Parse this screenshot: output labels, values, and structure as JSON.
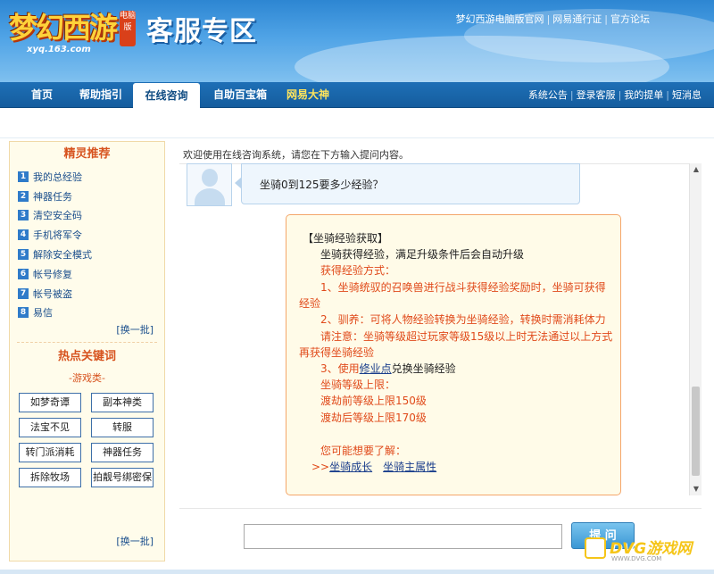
{
  "header": {
    "logo_text": "梦幻西游",
    "logo_badge": "电脑版",
    "logo_url": "xyq.163.com",
    "title": "客服专区",
    "links": [
      "梦幻西游电脑版官网",
      "网易通行证",
      "官方论坛"
    ]
  },
  "nav": {
    "tabs": [
      "首页",
      "帮助指引",
      "在线咨询",
      "自助百宝箱",
      "网易大神"
    ],
    "active_tab": "在线咨询",
    "right_links": [
      "系统公告",
      "登录客服",
      "我的提单",
      "短消息"
    ]
  },
  "sidebar": {
    "recommend_title": "精灵推荐",
    "items": [
      {
        "num": "1",
        "label": "我的总经验"
      },
      {
        "num": "2",
        "label": "神器任务"
      },
      {
        "num": "3",
        "label": "清空安全码"
      },
      {
        "num": "4",
        "label": "手机将军令"
      },
      {
        "num": "5",
        "label": "解除安全模式"
      },
      {
        "num": "6",
        "label": "帐号修复"
      },
      {
        "num": "7",
        "label": "帐号被盗"
      },
      {
        "num": "8",
        "label": "易信"
      }
    ],
    "refresh_label": "[换一批]",
    "hot_title": "热点关键词",
    "hot_category": "-游戏类-",
    "keywords": [
      "如梦奇谭",
      "副本神类",
      "法宝不见",
      "转服",
      "转门派消耗",
      "神器任务",
      "拆除牧场",
      "拍靓号绑密保"
    ],
    "refresh_label2": "[换一批]"
  },
  "chat": {
    "welcome": "欢迎使用在线咨询系统，请您在下方输入提问内容。",
    "question": "坐骑0到125要多少经验？",
    "answer": {
      "heading": "【坐骑经验获取】",
      "intro": "坐骑获得经验，满足升级条件后会自动升级",
      "method_title": "获得经验方式：",
      "method1_line1": "1、坐骑统驭的召唤兽进行战斗获得经验奖励时，坐骑可获得",
      "method1_line2": "经验",
      "method2": "2、驯养：可将人物经验转换为坐骑经验，转换时需消耗体力",
      "note_line1": "请注意：坐骑等级超过玩家等级15级以上时无法通过以上方式",
      "note_line2": "再获得坐骑经验",
      "method3_prefix": "3、使用",
      "method3_link": "修业点",
      "method3_suffix": "兑换坐骑经验",
      "limit_title": "坐骑等级上限：",
      "limit1": "渡劫前等级上限150级",
      "limit2": "渡劫后等级上限170级",
      "more_title": "您可能想要了解：",
      "more_prefix": ">>",
      "more_link1": "坐骑成长",
      "more_link2": "坐骑主属性"
    },
    "input_value": "",
    "submit_label": "提 问"
  },
  "watermark": {
    "text": "DVG游戏网",
    "sub": "WWW.DVG.COM"
  },
  "colors": {
    "header_blue": "#2d86d2",
    "nav_blue": "#1e6fb6",
    "accent_orange": "#e04a1a",
    "sidebar_bg": "#fffceb"
  }
}
